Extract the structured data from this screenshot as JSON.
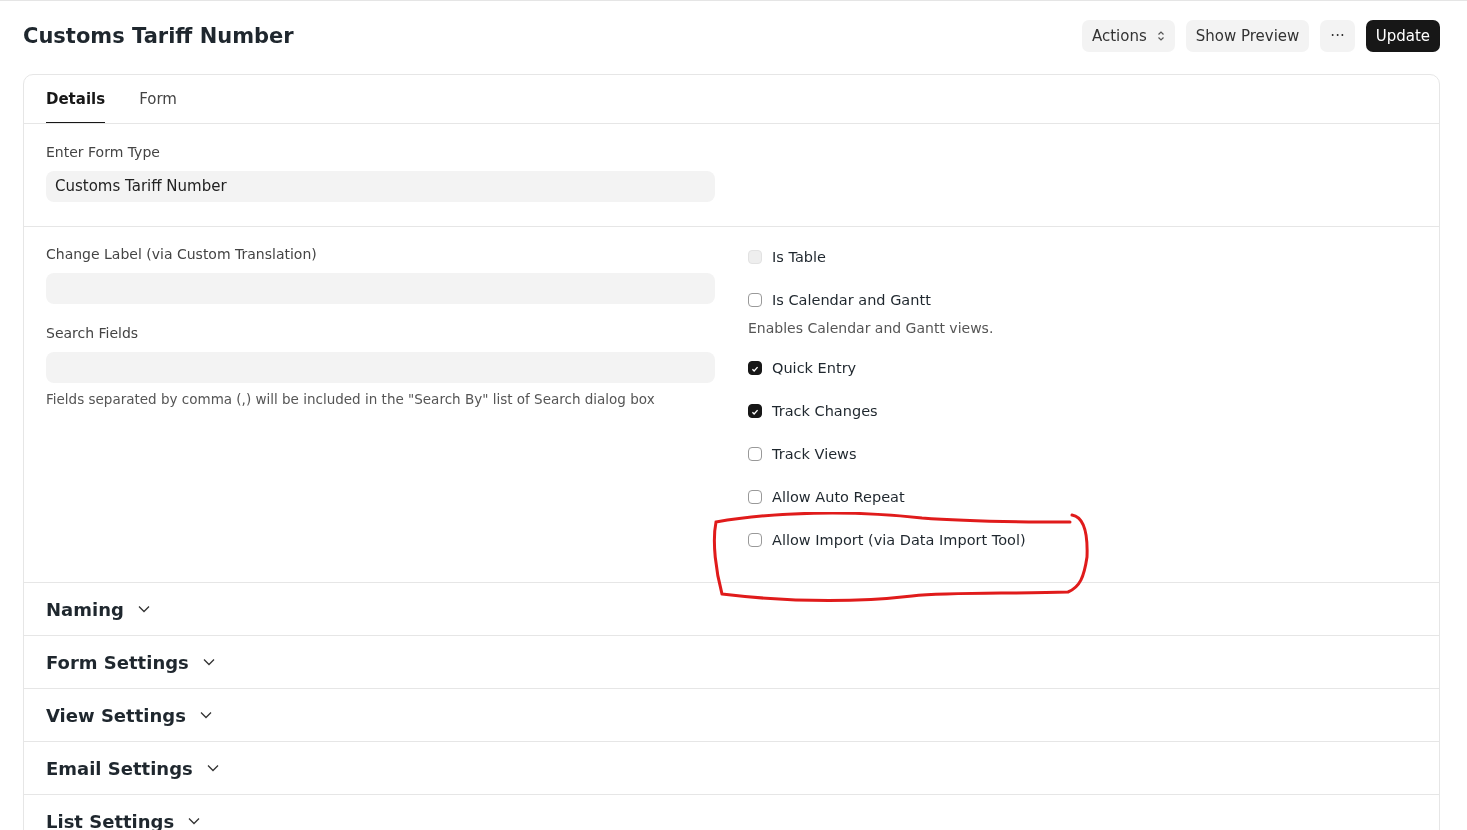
{
  "page": {
    "title": "Customs Tariff Number"
  },
  "actions": [
    {
      "label": "Actions",
      "kind": "dropdown"
    },
    {
      "label": "Show Preview",
      "kind": "plain"
    },
    {
      "label": "···",
      "kind": "plain"
    },
    {
      "label": "Update",
      "kind": "primary"
    }
  ],
  "tabs": [
    {
      "label": "Details",
      "selected": true
    },
    {
      "label": "Form",
      "selected": false
    }
  ],
  "form_type": {
    "label": "Enter Form Type",
    "value": "Customs Tariff Number"
  },
  "fields": [
    {
      "label": "Change Label (via Custom Translation)"
    },
    {
      "label": "Search Fields",
      "help": "Fields separated by comma (,) will be included in the \"Search By\" list of Search dialog box"
    }
  ],
  "checkboxes": [
    {
      "label": "Is Table",
      "checked": false,
      "disabled": true
    },
    {
      "label": "Is Calendar and Gantt",
      "checked": false,
      "disabled": false,
      "description": "Enables Calendar and Gantt views."
    },
    {
      "label": "Quick Entry",
      "checked": true,
      "disabled": false
    },
    {
      "label": "Track Changes",
      "checked": true,
      "disabled": false
    },
    {
      "label": "Track Views",
      "checked": false,
      "disabled": false
    },
    {
      "label": "Allow Auto Repeat",
      "checked": false,
      "disabled": false
    },
    {
      "label": "Allow Import (via Data Import Tool)",
      "checked": false,
      "disabled": false
    }
  ],
  "sections": [
    {
      "label": "Naming",
      "expanded": false
    },
    {
      "label": "Form Settings",
      "expanded": false
    },
    {
      "label": "View Settings",
      "expanded": false
    },
    {
      "label": "Email Settings",
      "expanded": false
    },
    {
      "label": "List Settings",
      "expanded": false
    }
  ]
}
